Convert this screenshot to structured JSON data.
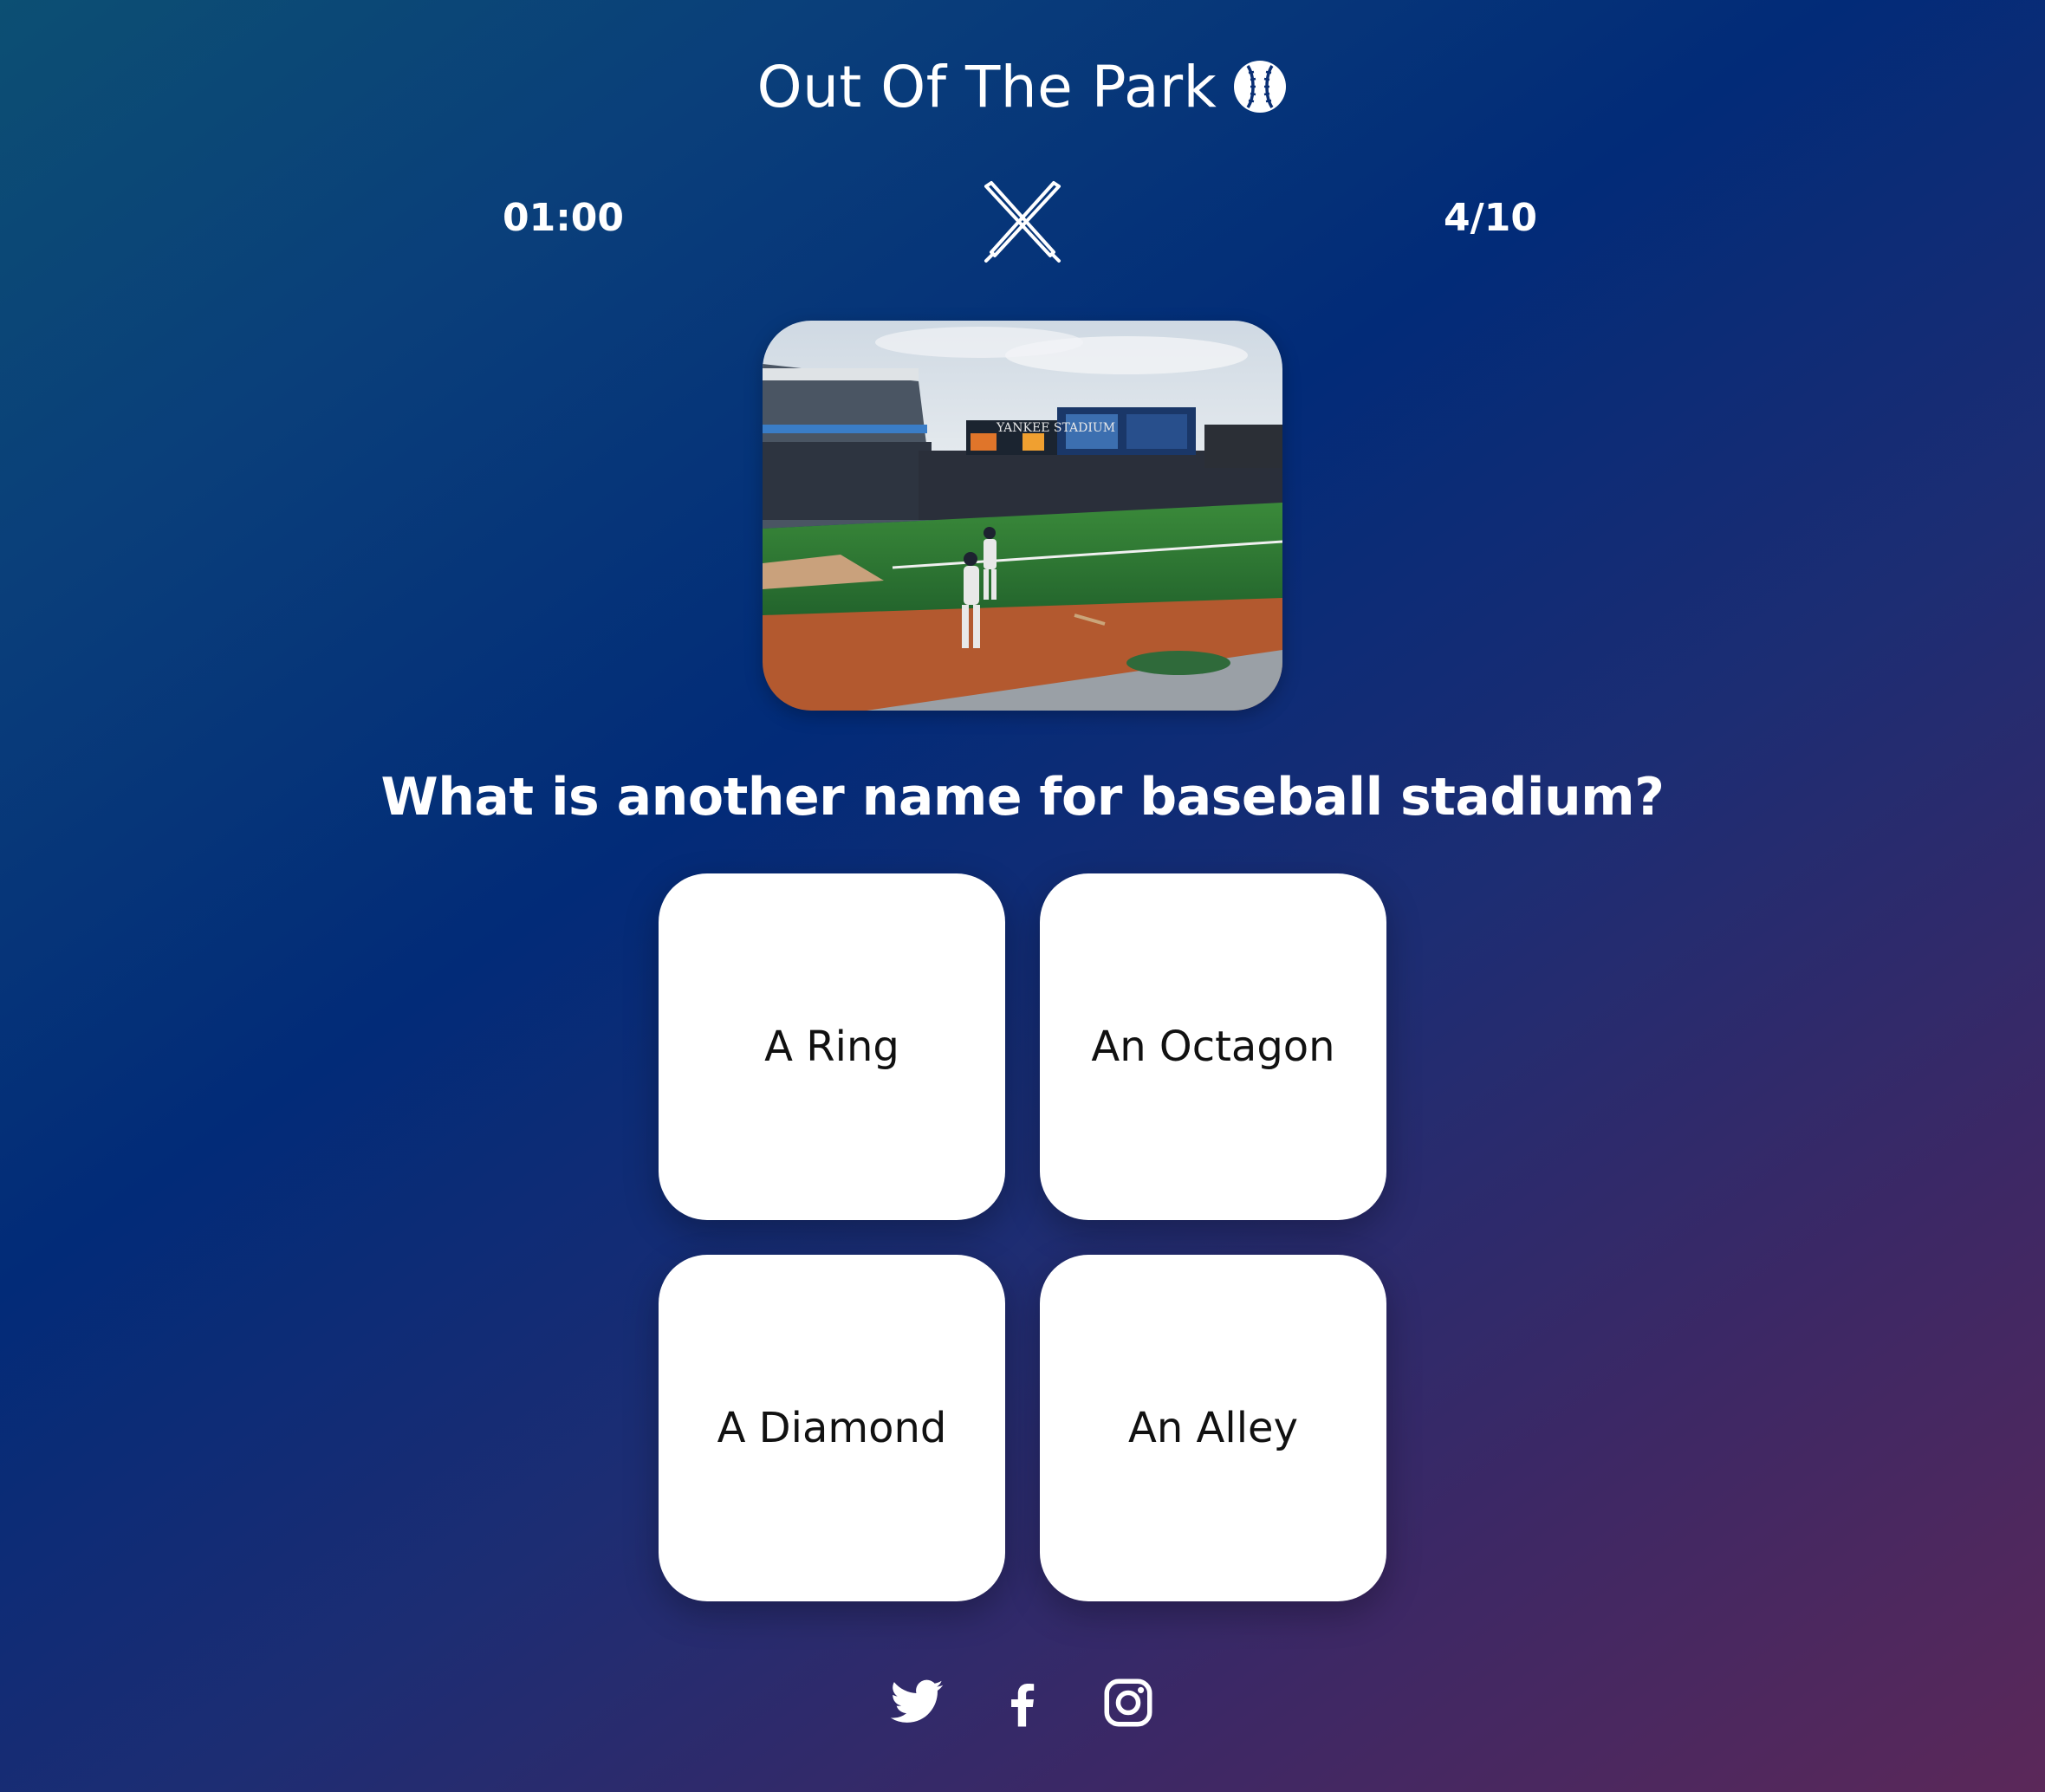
{
  "app": {
    "title": "Out Of The Park",
    "title_icon": "baseball-icon"
  },
  "status": {
    "timer": "01:00",
    "progress": "4/10",
    "center_icon": "crossed-bats-icon"
  },
  "question": {
    "image_alt": "Baseball stadium field",
    "text": "What is another name for baseball stadium?"
  },
  "answers": [
    {
      "label": "A Ring"
    },
    {
      "label": "An Octagon"
    },
    {
      "label": "A Diamond"
    },
    {
      "label": "An Alley"
    }
  ],
  "social": [
    {
      "icon": "twitter-icon"
    },
    {
      "icon": "facebook-icon"
    },
    {
      "icon": "instagram-icon"
    }
  ],
  "colors": {
    "background_start": "#0c4f73",
    "background_mid": "#022b78",
    "background_end": "#5b2859",
    "card": "#ffffff",
    "card_text": "#111111",
    "text": "#ffffff"
  }
}
